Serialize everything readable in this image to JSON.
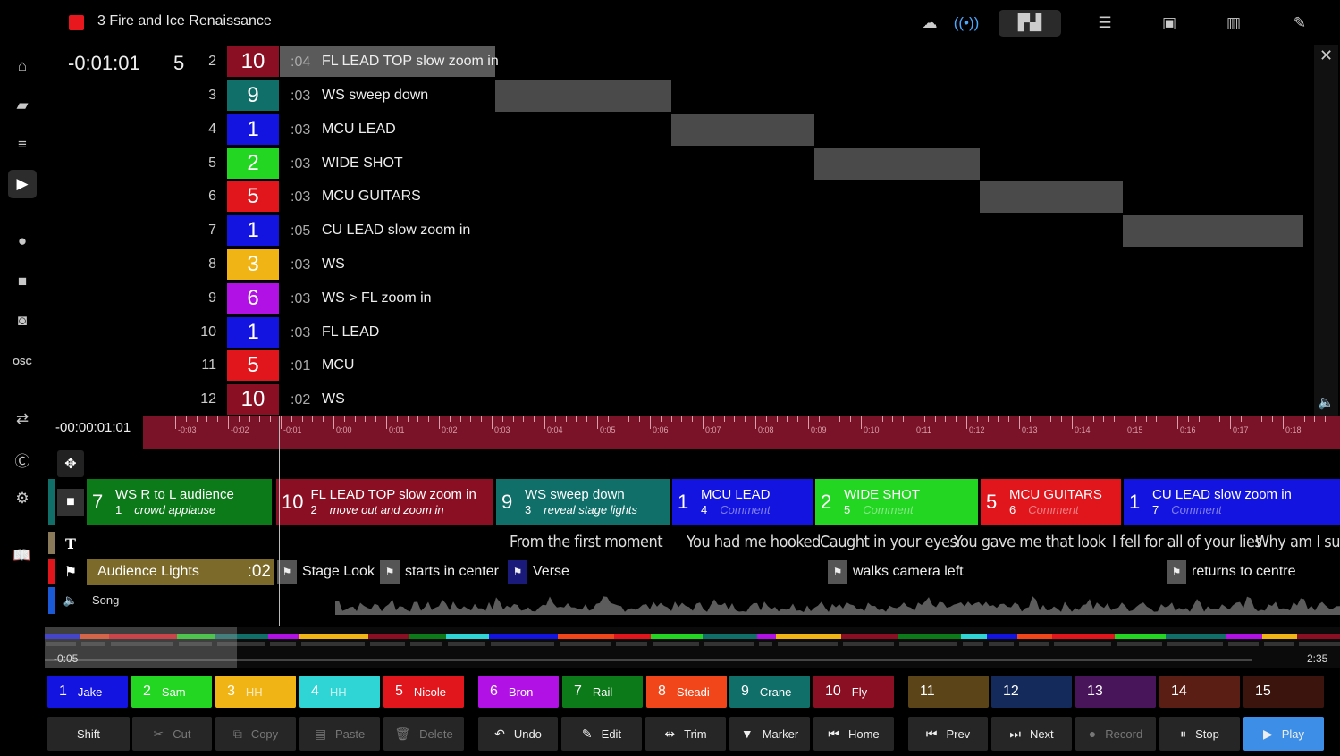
{
  "window": {
    "title": "3 Fire and Ice Renaissance"
  },
  "cue_panel": {
    "elapsed": "-0:01:01",
    "current_index": "5",
    "rows": [
      {
        "num": "2",
        "cam": "10",
        "dur": ":04",
        "desc": "FL LEAD TOP slow zoom in",
        "color": "#8a0f22"
      },
      {
        "num": "3",
        "cam": "9",
        "dur": ":03",
        "desc": "WS sweep down",
        "color": "#116f6a"
      },
      {
        "num": "4",
        "cam": "1",
        "dur": ":03",
        "desc": "MCU LEAD",
        "color": "#1414e0"
      },
      {
        "num": "5",
        "cam": "2",
        "dur": ":03",
        "desc": "WIDE SHOT",
        "color": "#22d622"
      },
      {
        "num": "6",
        "cam": "5",
        "dur": ":03",
        "desc": "MCU GUITARS",
        "color": "#e1151c"
      },
      {
        "num": "7",
        "cam": "1",
        "dur": ":05",
        "desc": "CU LEAD slow zoom in",
        "color": "#1414e0"
      },
      {
        "num": "8",
        "cam": "3",
        "dur": ":03",
        "desc": "WS",
        "color": "#f0b515"
      },
      {
        "num": "9",
        "cam": "6",
        "dur": ":03",
        "desc": "WS > FL zoom in",
        "color": "#b211e6"
      },
      {
        "num": "10",
        "cam": "1",
        "dur": ":03",
        "desc": "FL LEAD",
        "color": "#1414e0"
      },
      {
        "num": "11",
        "cam": "5",
        "dur": ":01",
        "desc": "MCU",
        "color": "#e1151c"
      },
      {
        "num": "12",
        "cam": "10",
        "dur": ":02",
        "desc": "WS",
        "color": "#8a0f22"
      }
    ]
  },
  "ruler": {
    "time": "-00:00:01:01",
    "ticks": [
      "-0:03",
      "-0:02",
      "-0:01",
      "0:00",
      "0:01",
      "0:02",
      "0:03",
      "0:04",
      "0:05",
      "0:06",
      "0:07",
      "0:08",
      "0:09",
      "0:10",
      "0:11",
      "0:12",
      "0:13",
      "0:14",
      "0:15",
      "0:16",
      "0:17",
      "0:18"
    ]
  },
  "shots": [
    {
      "cam": "7",
      "desc": "WS R to L audience",
      "idx": "1",
      "comment": "crowd applause",
      "color": "#0d7a1a"
    },
    {
      "cam": "10",
      "desc": "FL LEAD TOP slow zoom in",
      "idx": "2",
      "comment": "move out and zoom in",
      "color": "#8a0f22"
    },
    {
      "cam": "9",
      "desc": "WS sweep down",
      "idx": "3",
      "comment": "reveal stage lights",
      "color": "#116f6a"
    },
    {
      "cam": "1",
      "desc": "MCU LEAD",
      "idx": "4",
      "comment": "Comment",
      "color": "#1414e0"
    },
    {
      "cam": "2",
      "desc": "WIDE SHOT",
      "idx": "5",
      "comment": "Comment",
      "color": "#22d622"
    },
    {
      "cam": "5",
      "desc": "MCU GUITARS",
      "idx": "6",
      "comment": "Comment",
      "color": "#e1151c"
    },
    {
      "cam": "1",
      "desc": "CU LEAD slow zoom in",
      "idx": "7",
      "comment": "Comment",
      "color": "#1414e0"
    }
  ],
  "lyrics": [
    "From the first moment",
    "You had me hooked",
    "Caught in your eyes",
    "You gave me that look",
    "I fell for all of your lies",
    "Why am I sup"
  ],
  "markers": {
    "audience_lights": {
      "label": "Audience Lights",
      "dur": ":02"
    },
    "items": [
      "Stage Look",
      "starts in center",
      "Verse",
      "walks camera left",
      "returns to centre"
    ]
  },
  "audio": {
    "label": "Song"
  },
  "minimap": {
    "start": "-0:05",
    "end": "2:35"
  },
  "cameras": [
    {
      "num": "1",
      "name": "Jake",
      "color": "#1414e0"
    },
    {
      "num": "2",
      "name": "Sam",
      "color": "#22d622"
    },
    {
      "num": "3",
      "name": "HH",
      "color": "#f0b515"
    },
    {
      "num": "4",
      "name": "HH",
      "color": "#2fd4d4"
    },
    {
      "num": "5",
      "name": "Nicole",
      "color": "#e1151c"
    },
    {
      "num": "6",
      "name": "Bron",
      "color": "#b211e6"
    },
    {
      "num": "7",
      "name": "Rail",
      "color": "#0d7a1a"
    },
    {
      "num": "8",
      "name": "Steadi",
      "color": "#f0461a"
    },
    {
      "num": "9",
      "name": "Crane",
      "color": "#116f6a"
    },
    {
      "num": "10",
      "name": "Fly",
      "color": "#8a0f22"
    },
    {
      "num": "11",
      "name": "",
      "color": "#5a4418"
    },
    {
      "num": "12",
      "name": "",
      "color": "#142a5a"
    },
    {
      "num": "13",
      "name": "",
      "color": "#48145a"
    },
    {
      "num": "14",
      "name": "",
      "color": "#5a1e14"
    },
    {
      "num": "15",
      "name": "",
      "color": "#3a140d"
    }
  ],
  "controls": {
    "shift": "Shift",
    "cut": "Cut",
    "copy": "Copy",
    "paste": "Paste",
    "delete": "Delete",
    "undo": "Undo",
    "edit": "Edit",
    "trim": "Trim",
    "marker": "Marker",
    "home": "Home",
    "prev": "Prev",
    "next": "Next",
    "record": "Record",
    "stop": "Stop",
    "play": "Play"
  }
}
